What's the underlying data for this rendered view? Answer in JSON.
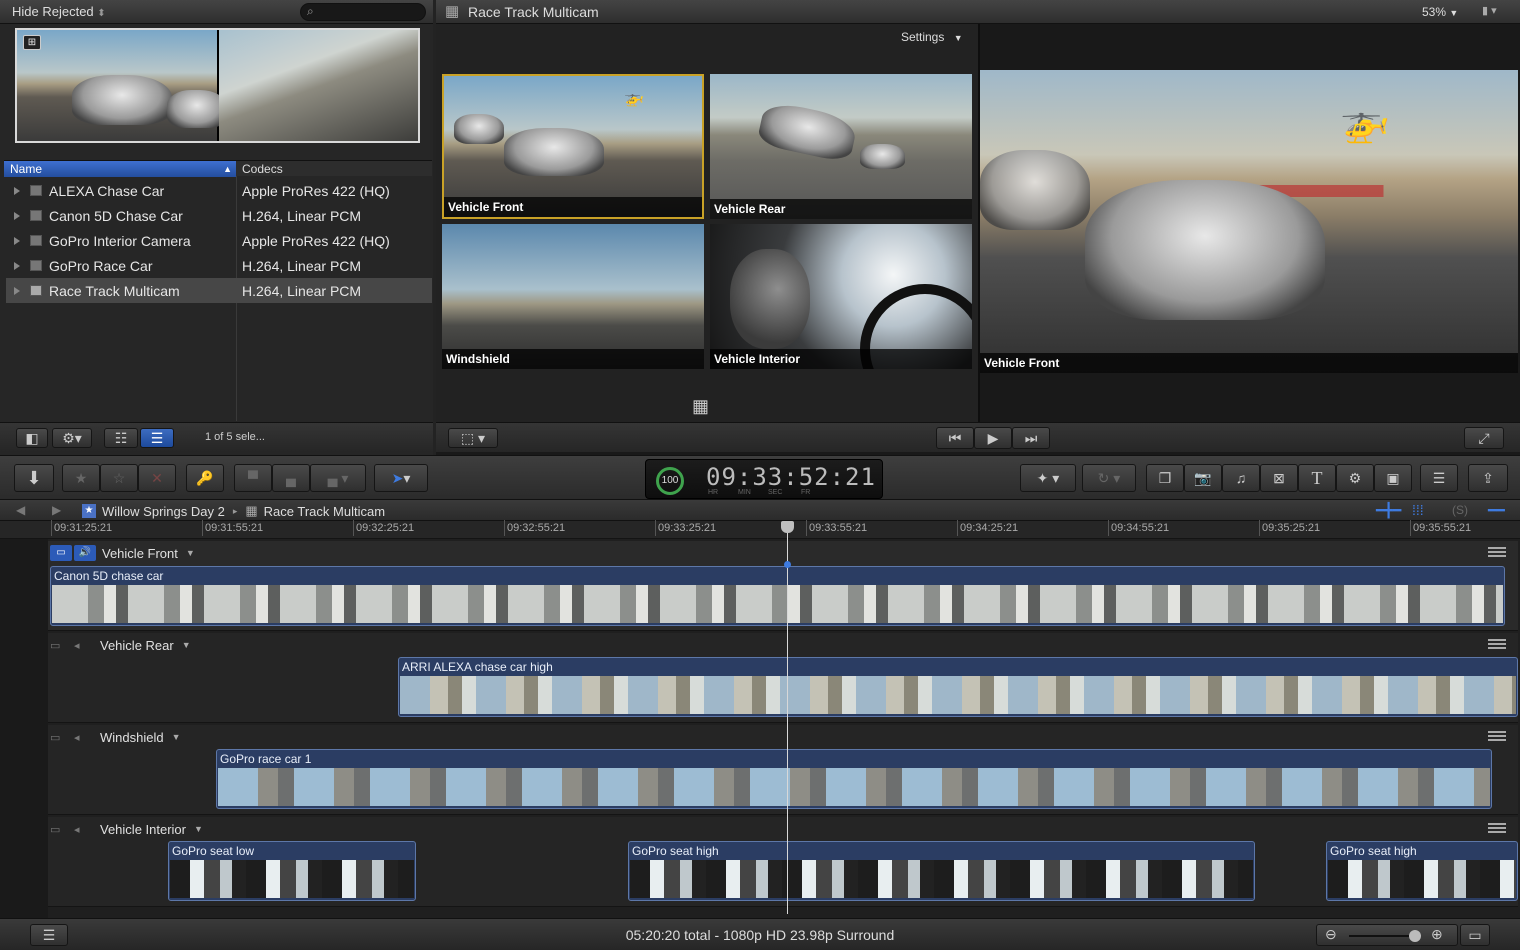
{
  "browser": {
    "filter_label": "Hide Rejected",
    "search_placeholder": "",
    "columns": {
      "name": "Name",
      "codecs": "Codecs"
    },
    "rows": [
      {
        "name": "ALEXA Chase Car",
        "codec": "Apple ProRes 422 (HQ)"
      },
      {
        "name": "Canon 5D Chase Car",
        "codec": "H.264, Linear PCM"
      },
      {
        "name": "GoPro Interior Camera",
        "codec": "Apple ProRes 422 (HQ)"
      },
      {
        "name": "GoPro Race Car",
        "codec": "H.264, Linear PCM"
      },
      {
        "name": "Race Track Multicam",
        "codec": "H.264, Linear PCM"
      }
    ],
    "selection_status": "1 of 5 sele..."
  },
  "viewer": {
    "title": "Race Track Multicam",
    "zoom": "53%",
    "settings_label": "Settings",
    "angles": [
      "Vehicle Front",
      "Vehicle Rear",
      "Windshield",
      "Vehicle Interior"
    ],
    "main_angle": "Vehicle Front"
  },
  "toolbar": {
    "timecode": "09:33:52:21",
    "timecode_units": [
      "HR",
      "MIN",
      "SEC",
      "FR"
    ],
    "progress_badge": "100"
  },
  "timeline": {
    "breadcrumb": [
      "Willow Springs Day 2",
      "Race Track Multicam"
    ],
    "ruler": [
      "09:31:25:21",
      "09:31:55:21",
      "09:32:25:21",
      "09:32:55:21",
      "09:33:25:21",
      "09:33:55:21",
      "09:34:25:21",
      "09:34:55:21",
      "09:35:25:21",
      "09:35:55:21"
    ],
    "lanes": [
      {
        "name": "Vehicle Front",
        "clips": [
          "Canon 5D chase car"
        ]
      },
      {
        "name": "Vehicle Rear",
        "clips": [
          "ARRI ALEXA chase car high"
        ]
      },
      {
        "name": "Windshield",
        "clips": [
          "GoPro race car 1"
        ]
      },
      {
        "name": "Vehicle Interior",
        "clips": [
          "GoPro seat low",
          "GoPro seat high",
          "GoPro seat high"
        ]
      }
    ]
  },
  "status_bar": {
    "summary": "05:20:20 total - 1080p HD 23.98p Surround"
  },
  "colors": {
    "accent": "#2c5bb8",
    "clip": "#2b3d63",
    "playhead": "#d8d8d8"
  }
}
